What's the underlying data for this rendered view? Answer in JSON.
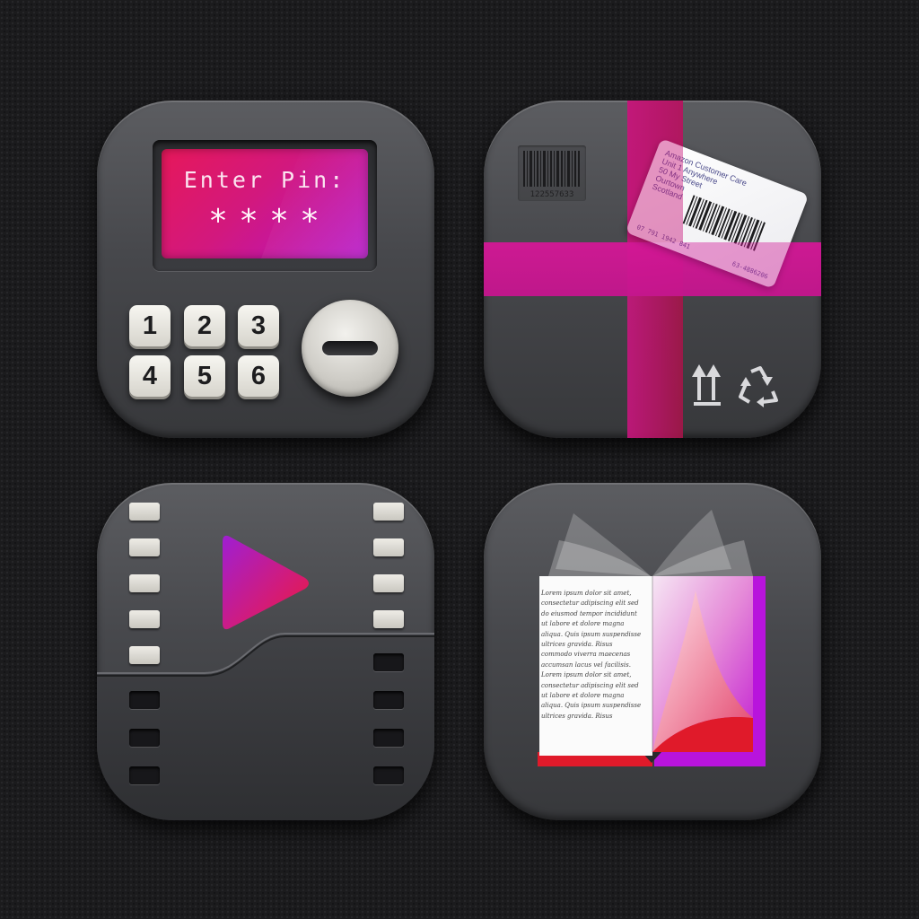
{
  "pin_pad": {
    "screen_title": "Enter Pin:",
    "screen_mask": "****",
    "keys": [
      "1",
      "2",
      "3",
      "4",
      "5",
      "6"
    ],
    "accent": "#d81a8c"
  },
  "package": {
    "barcode_number": "122557633",
    "label_lines": [
      "Amazon Customer Care",
      "Unit 1 Anywhere",
      "50 My Street",
      "Ourtown",
      "Scotland"
    ],
    "label_number_left": "07 791 1942 841",
    "label_number_right": "63-4886206",
    "icons": [
      "this-way-up-icon",
      "recycle-icon"
    ],
    "tape_color": "#c8157e"
  },
  "video": {
    "icons": [
      "play-icon",
      "film-strip-icon"
    ],
    "play_gradient": [
      "#a61fd0",
      "#e01848"
    ]
  },
  "book": {
    "page_lines": [
      "Lorem ipsum dolor sit amet,",
      "consectetur adipiscing elit sed",
      "do eiusmod tempor incididunt",
      "ut labore et dolore magna",
      "aliqua. Quis ipsum suspendisse",
      "ultrices gravida. Risus",
      "commodo viverra maecenas",
      "accumsan lacus vel facilisis.",
      "Lorem ipsum dolor sit amet,",
      "consectetur adipiscing elit sed",
      "ut labore et dolore magna",
      "aliqua. Quis ipsum suspendisse",
      "ultrices gravida. Risus"
    ],
    "cover_colors": [
      "#e01a2a",
      "#b814dc"
    ]
  }
}
